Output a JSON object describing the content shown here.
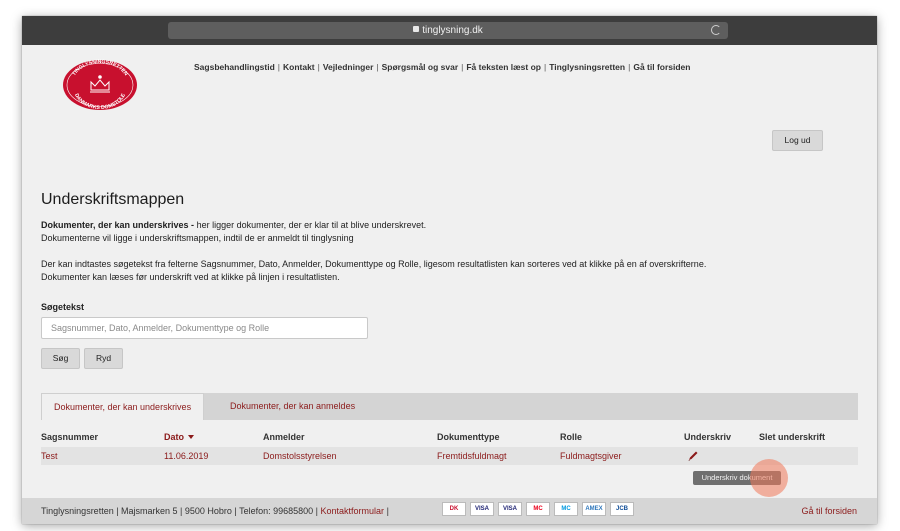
{
  "browser": {
    "url": "tinglysning.dk"
  },
  "logo": {
    "top_text": "TINGLYSNINGSRETTEN",
    "bottom_text": "DANMARKS DOMSTOLE"
  },
  "nav": {
    "items": [
      "Sagsbehandlingstid",
      "Kontakt",
      "Vejledninger",
      "Spørgsmål og svar",
      "Få teksten læst op",
      "Tinglysningsretten",
      "Gå til forsiden"
    ],
    "separator": "|"
  },
  "logout_label": "Log ud",
  "page": {
    "title": "Underskriftsmappen",
    "intro_bold": "Dokumenter, der kan underskrives -",
    "intro_rest": " her ligger dokumenter, der er klar til at blive underskrevet.",
    "intro_line2": "Dokumenterne vil ligge i underskriftsmappen, indtil de er anmeldt til tinglysning",
    "help_line1": "Der kan indtastes søgetekst fra felterne Sagsnummer, Dato, Anmelder, Dokumenttype og Rolle, ligesom resultatlisten kan sorteres ved at klikke på en af overskrifterne.",
    "help_line2": "Dokumenter kan læses før underskrift ved at klikke på linjen i resultatlisten."
  },
  "search": {
    "label": "Søgetekst",
    "placeholder": "Sagsnummer, Dato, Anmelder, Dokumenttype og Rolle",
    "value": "",
    "search_label": "Søg",
    "clear_label": "Ryd"
  },
  "tabs": [
    {
      "label": "Dokumenter, der kan underskrives",
      "active": true
    },
    {
      "label": "Dokumenter, der kan anmeldes",
      "active": false
    }
  ],
  "table": {
    "columns": [
      "Sagsnummer",
      "Dato",
      "Anmelder",
      "Dokumenttype",
      "Rolle",
      "Underskriv",
      "Slet underskrift"
    ],
    "rows": [
      {
        "sagsnummer": "Test",
        "dato": "11.06.2019",
        "anmelder": "Domstolsstyrelsen",
        "dokumenttype": "Fremtidsfuldmagt",
        "rolle": "Fuldmagtsgiver"
      }
    ]
  },
  "tooltip": "Underskriv dokument",
  "footer": {
    "address": "Tinglysningsretten | Majsmarken 5 | 9500 Hobro | Telefon: 99685800 |",
    "contact_link": "Kontaktformular",
    "after_contact": " |",
    "home_link": "Gå til forsiden",
    "cards": [
      "DK",
      "VISA",
      "VISA",
      "MC",
      "MC",
      "AMEX",
      "JCB"
    ]
  },
  "colors": {
    "accent": "#8b1a1a",
    "page_bg": "#f0f0f0",
    "footer_bg": "#d6d6d6",
    "tab_bar_bg": "#d4d4d4",
    "logo_red": "#c8102e"
  }
}
